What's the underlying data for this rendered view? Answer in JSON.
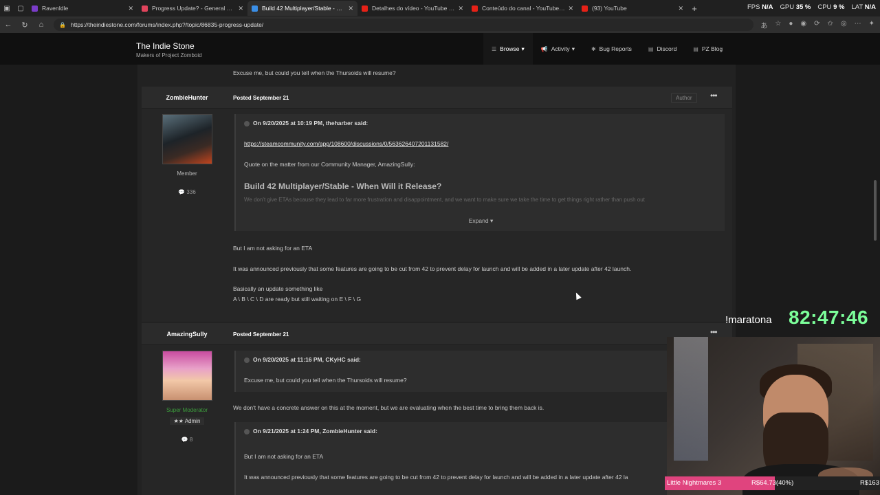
{
  "browser": {
    "tabs": [
      {
        "label": "RavenIdle",
        "favicon_color": "#7a3cc8",
        "active": false
      },
      {
        "label": "Progress Update? - General Discu",
        "favicon_color": "#e0445c",
        "active": false
      },
      {
        "label": "Build 42 Multiplayer/Stable - Whe",
        "favicon_color": "#3a8ee6",
        "active": true
      },
      {
        "label": "Detalhes do vídeo - YouTube Stu",
        "favicon_color": "#e62117",
        "active": false
      },
      {
        "label": "Conteúdo do canal - YouTube Stu",
        "favicon_color": "#e62117",
        "active": false
      },
      {
        "label": "(93) YouTube",
        "favicon_color": "#e62117",
        "active": false
      }
    ],
    "tab_close": "✕",
    "new_tab": "+",
    "url": "https://theindiestone.com/forums/index.php?/topic/86835-progress-update/",
    "perf": {
      "fps_label": "FPS",
      "fps": "N/A",
      "gpu_label": "GPU",
      "gpu": "35 %",
      "cpu_label": "CPU",
      "cpu": "9 %",
      "lat_label": "LAT",
      "lat": "N/A"
    }
  },
  "site": {
    "name": "The Indie Stone",
    "tagline": "Makers of Project Zomboid",
    "nav": [
      {
        "label": "Browse",
        "icon": "list-icon",
        "active": true
      },
      {
        "label": "Activity",
        "icon": "megaphone-icon",
        "active": false
      },
      {
        "label": "Bug Reports",
        "icon": "bug-icon",
        "active": false
      },
      {
        "label": "Discord",
        "icon": "page-icon",
        "active": false
      },
      {
        "label": "PZ Blog",
        "icon": "page-icon",
        "active": false
      }
    ]
  },
  "thread": {
    "top_fragment": "Excuse me, but could you tell when the Thursoids will resume?",
    "posts": [
      {
        "author": "ZombieHunter",
        "date_prefix": "Posted",
        "date": "September 21",
        "badge": "Author",
        "role": "Member",
        "post_count": "336",
        "quote": {
          "header": "On 9/20/2025 at 10:19 PM, theharber said:",
          "link": "https://steamcommunity.com/app/108600/discussions/0/563626407201131582/",
          "line1": "Quote on the matter from our Community Manager, AmazingSully:",
          "title": "Build 42 Multiplayer/Stable - When Will it Release?",
          "faded": "We don't give ETAs because they lead to far more frustration and disappointment, and we want to make sure we take the time to get things right rather than push out",
          "expand": "Expand"
        },
        "body": [
          "But I am not asking for an ETA",
          "It was announced previously that some features are going to be cut from 42 to prevent delay for launch and will be added in a later update after 42 launch.",
          "Basically an update something like",
          "A \\ B \\ C \\ D are ready  but still waiting on E \\ F \\ G"
        ]
      },
      {
        "author": "AmazingSully",
        "date_prefix": "Posted",
        "date": "September 21",
        "role": "Super Moderator",
        "rank": "★★ Admin",
        "post_count": "8",
        "quote1": {
          "header": "On 9/20/2025 at 11:16 PM, CKyHC said:",
          "line": "Excuse me, but could you tell when the Thursoids will resume?"
        },
        "reply": "We don't have a concrete answer on this at the moment, but we are evaluating when the best time to bring them back is.",
        "quote2": {
          "header": "On 9/21/2025 at 1:24 PM, ZombieHunter said:",
          "line1": "But I am not asking for an ETA",
          "line2": "It was announced previously that some features are going to be cut from 42 to prevent delay for launch and will be added in a later update after 42 la"
        }
      }
    ]
  },
  "overlay": {
    "command": "!maratona",
    "timer": "82:47:46",
    "game": "Little Nightmares 3",
    "price": "R$64.73(40%)",
    "price2": "R$163",
    "progress": 0.4,
    "accent": "#e0447e"
  }
}
